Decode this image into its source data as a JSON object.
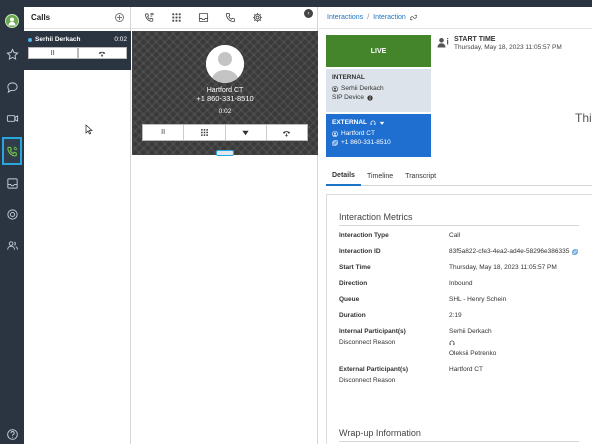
{
  "rail": {
    "items": [
      "avatar",
      "star-icon",
      "chat-icon",
      "video-icon",
      "phone-active-icon",
      "inbox-icon",
      "support-icon",
      "people-icon",
      "help-icon"
    ]
  },
  "calls": {
    "title": "Calls",
    "item": {
      "name": "Serhii Derkach",
      "time": "0:02"
    },
    "hold_label": "II"
  },
  "call_panel": {
    "name": "Hartford CT",
    "number": "+1 860-331-8510",
    "timer": "0:02",
    "hold_label": "II"
  },
  "breadcrumb": {
    "root": "Interactions",
    "sep": "/",
    "current": "Interaction"
  },
  "status": {
    "live": "LIVE",
    "internal_title": "INTERNAL",
    "internal_user": "Serhii Derkach",
    "internal_device": "SIP Device",
    "external_title": "EXTERNAL",
    "external_name": "Hartford CT",
    "external_number": "+1 860-331-8510"
  },
  "start": {
    "label": "START TIME",
    "value": "Thursday, May 18, 2023 11:05:57 PM"
  },
  "truncated_text": "Thi",
  "tabs": [
    "Details",
    "Timeline",
    "Transcript"
  ],
  "metrics": {
    "title": "Interaction Metrics",
    "rows": [
      {
        "k": "Interaction Type",
        "v": "Call"
      },
      {
        "k": "Interaction ID",
        "v": "83f5a822-cfe3-4ea2-ad4e-58296e386335"
      },
      {
        "k": "Start Time",
        "v": "Thursday, May 18, 2023 11:05:57 PM"
      },
      {
        "k": "Direction",
        "v": "Inbound"
      },
      {
        "k": "Queue",
        "v": "SHL - Henry Schein"
      },
      {
        "k": "Duration",
        "v": "2:19"
      }
    ],
    "internal_participants_label": "Internal Participant(s)",
    "internal_participant_1": "Serhii Derkach",
    "internal_participant_2": "Oleksii Petrenko",
    "disconnect_reason_label": "Disconnect Reason",
    "external_participants_label": "External Participant(s)",
    "external_participant": "Hartford CT",
    "disconnect_reason_label_2": "Disconnect Reason"
  },
  "wrapup": {
    "title": "Wrap-up Information"
  },
  "colors": {
    "rail": "#2b3541",
    "live": "#44852c",
    "external": "#1f6fd1",
    "internal": "#dde3ea",
    "accent": "#2aa6df",
    "link": "#1a73c7"
  }
}
